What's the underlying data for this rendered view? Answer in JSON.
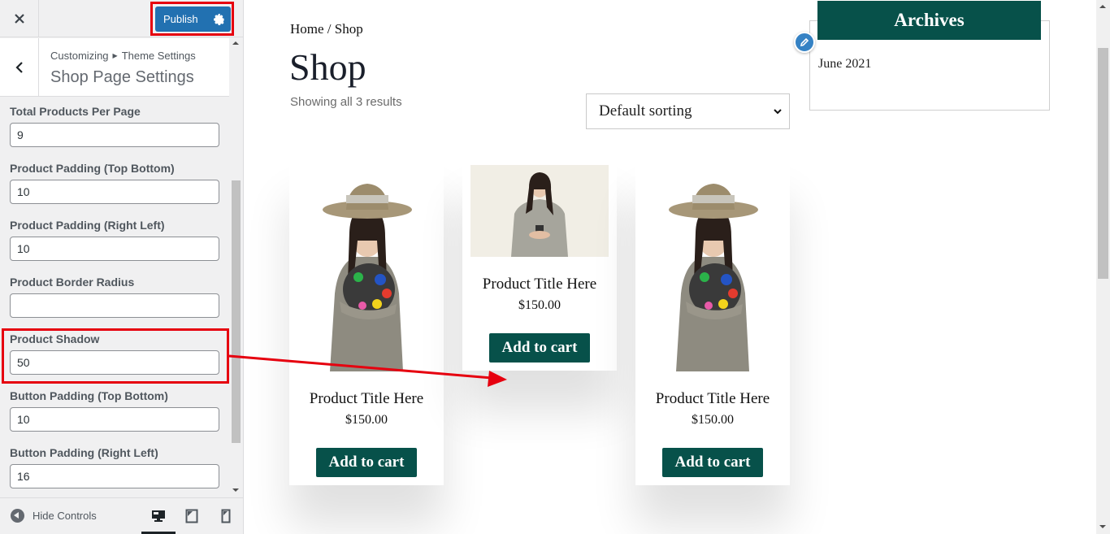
{
  "customizer": {
    "close_label": "Close",
    "publish_label": "Publish",
    "breadcrumb": [
      "Customizing",
      "Theme Settings"
    ],
    "section_title": "Shop Page Settings",
    "controls": [
      {
        "label": "Total Products Per Page",
        "value": "9"
      },
      {
        "label": "Product Padding (Top Bottom)",
        "value": "10"
      },
      {
        "label": "Product Padding (Right Left)",
        "value": "10"
      },
      {
        "label": "Product Border Radius",
        "value": ""
      },
      {
        "label": "Product Shadow",
        "value": "50"
      },
      {
        "label": "Button Padding (Top Bottom)",
        "value": "10"
      },
      {
        "label": "Button Padding (Right Left)",
        "value": "16"
      }
    ],
    "footer": {
      "hide_controls_label": "Hide Controls",
      "devices": [
        "desktop",
        "tablet",
        "mobile"
      ],
      "active_device": "desktop"
    }
  },
  "preview": {
    "breadcrumb": "Home / Shop",
    "page_title": "Shop",
    "result_count": "Showing all 3 results",
    "sorting": {
      "selected": "Default sorting"
    },
    "archives": {
      "title": "Archives",
      "items": [
        "June 2021"
      ]
    },
    "products": [
      {
        "title": "Product Title Here",
        "price": "$150.00",
        "button": "Add to cart",
        "image": "woman-hat-palette"
      },
      {
        "title": "Product Title Here",
        "price": "$150.00",
        "button": "Add to cart",
        "image": "woman-phone"
      },
      {
        "title": "Product Title Here",
        "price": "$150.00",
        "button": "Add to cart",
        "image": "woman-hat-palette"
      }
    ]
  },
  "colors": {
    "publish": "#2271b1",
    "brand_green": "#07514a",
    "annotation_red": "#e6000f",
    "edit_shortcut": "#3582c4"
  }
}
